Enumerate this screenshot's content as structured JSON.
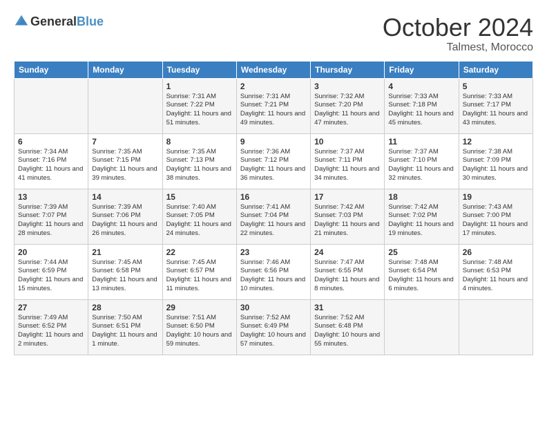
{
  "logo": {
    "text_general": "General",
    "text_blue": "Blue"
  },
  "header": {
    "month": "October 2024",
    "location": "Talmest, Morocco"
  },
  "weekdays": [
    "Sunday",
    "Monday",
    "Tuesday",
    "Wednesday",
    "Thursday",
    "Friday",
    "Saturday"
  ],
  "weeks": [
    [
      {
        "day": "",
        "info": ""
      },
      {
        "day": "",
        "info": ""
      },
      {
        "day": "1",
        "info": "Sunrise: 7:31 AM\nSunset: 7:22 PM\nDaylight: 11 hours and 51 minutes."
      },
      {
        "day": "2",
        "info": "Sunrise: 7:31 AM\nSunset: 7:21 PM\nDaylight: 11 hours and 49 minutes."
      },
      {
        "day": "3",
        "info": "Sunrise: 7:32 AM\nSunset: 7:20 PM\nDaylight: 11 hours and 47 minutes."
      },
      {
        "day": "4",
        "info": "Sunrise: 7:33 AM\nSunset: 7:18 PM\nDaylight: 11 hours and 45 minutes."
      },
      {
        "day": "5",
        "info": "Sunrise: 7:33 AM\nSunset: 7:17 PM\nDaylight: 11 hours and 43 minutes."
      }
    ],
    [
      {
        "day": "6",
        "info": "Sunrise: 7:34 AM\nSunset: 7:16 PM\nDaylight: 11 hours and 41 minutes."
      },
      {
        "day": "7",
        "info": "Sunrise: 7:35 AM\nSunset: 7:15 PM\nDaylight: 11 hours and 39 minutes."
      },
      {
        "day": "8",
        "info": "Sunrise: 7:35 AM\nSunset: 7:13 PM\nDaylight: 11 hours and 38 minutes."
      },
      {
        "day": "9",
        "info": "Sunrise: 7:36 AM\nSunset: 7:12 PM\nDaylight: 11 hours and 36 minutes."
      },
      {
        "day": "10",
        "info": "Sunrise: 7:37 AM\nSunset: 7:11 PM\nDaylight: 11 hours and 34 minutes."
      },
      {
        "day": "11",
        "info": "Sunrise: 7:37 AM\nSunset: 7:10 PM\nDaylight: 11 hours and 32 minutes."
      },
      {
        "day": "12",
        "info": "Sunrise: 7:38 AM\nSunset: 7:09 PM\nDaylight: 11 hours and 30 minutes."
      }
    ],
    [
      {
        "day": "13",
        "info": "Sunrise: 7:39 AM\nSunset: 7:07 PM\nDaylight: 11 hours and 28 minutes."
      },
      {
        "day": "14",
        "info": "Sunrise: 7:39 AM\nSunset: 7:06 PM\nDaylight: 11 hours and 26 minutes."
      },
      {
        "day": "15",
        "info": "Sunrise: 7:40 AM\nSunset: 7:05 PM\nDaylight: 11 hours and 24 minutes."
      },
      {
        "day": "16",
        "info": "Sunrise: 7:41 AM\nSunset: 7:04 PM\nDaylight: 11 hours and 22 minutes."
      },
      {
        "day": "17",
        "info": "Sunrise: 7:42 AM\nSunset: 7:03 PM\nDaylight: 11 hours and 21 minutes."
      },
      {
        "day": "18",
        "info": "Sunrise: 7:42 AM\nSunset: 7:02 PM\nDaylight: 11 hours and 19 minutes."
      },
      {
        "day": "19",
        "info": "Sunrise: 7:43 AM\nSunset: 7:00 PM\nDaylight: 11 hours and 17 minutes."
      }
    ],
    [
      {
        "day": "20",
        "info": "Sunrise: 7:44 AM\nSunset: 6:59 PM\nDaylight: 11 hours and 15 minutes."
      },
      {
        "day": "21",
        "info": "Sunrise: 7:45 AM\nSunset: 6:58 PM\nDaylight: 11 hours and 13 minutes."
      },
      {
        "day": "22",
        "info": "Sunrise: 7:45 AM\nSunset: 6:57 PM\nDaylight: 11 hours and 11 minutes."
      },
      {
        "day": "23",
        "info": "Sunrise: 7:46 AM\nSunset: 6:56 PM\nDaylight: 11 hours and 10 minutes."
      },
      {
        "day": "24",
        "info": "Sunrise: 7:47 AM\nSunset: 6:55 PM\nDaylight: 11 hours and 8 minutes."
      },
      {
        "day": "25",
        "info": "Sunrise: 7:48 AM\nSunset: 6:54 PM\nDaylight: 11 hours and 6 minutes."
      },
      {
        "day": "26",
        "info": "Sunrise: 7:48 AM\nSunset: 6:53 PM\nDaylight: 11 hours and 4 minutes."
      }
    ],
    [
      {
        "day": "27",
        "info": "Sunrise: 7:49 AM\nSunset: 6:52 PM\nDaylight: 11 hours and 2 minutes."
      },
      {
        "day": "28",
        "info": "Sunrise: 7:50 AM\nSunset: 6:51 PM\nDaylight: 11 hours and 1 minute."
      },
      {
        "day": "29",
        "info": "Sunrise: 7:51 AM\nSunset: 6:50 PM\nDaylight: 10 hours and 59 minutes."
      },
      {
        "day": "30",
        "info": "Sunrise: 7:52 AM\nSunset: 6:49 PM\nDaylight: 10 hours and 57 minutes."
      },
      {
        "day": "31",
        "info": "Sunrise: 7:52 AM\nSunset: 6:48 PM\nDaylight: 10 hours and 55 minutes."
      },
      {
        "day": "",
        "info": ""
      },
      {
        "day": "",
        "info": ""
      }
    ]
  ]
}
